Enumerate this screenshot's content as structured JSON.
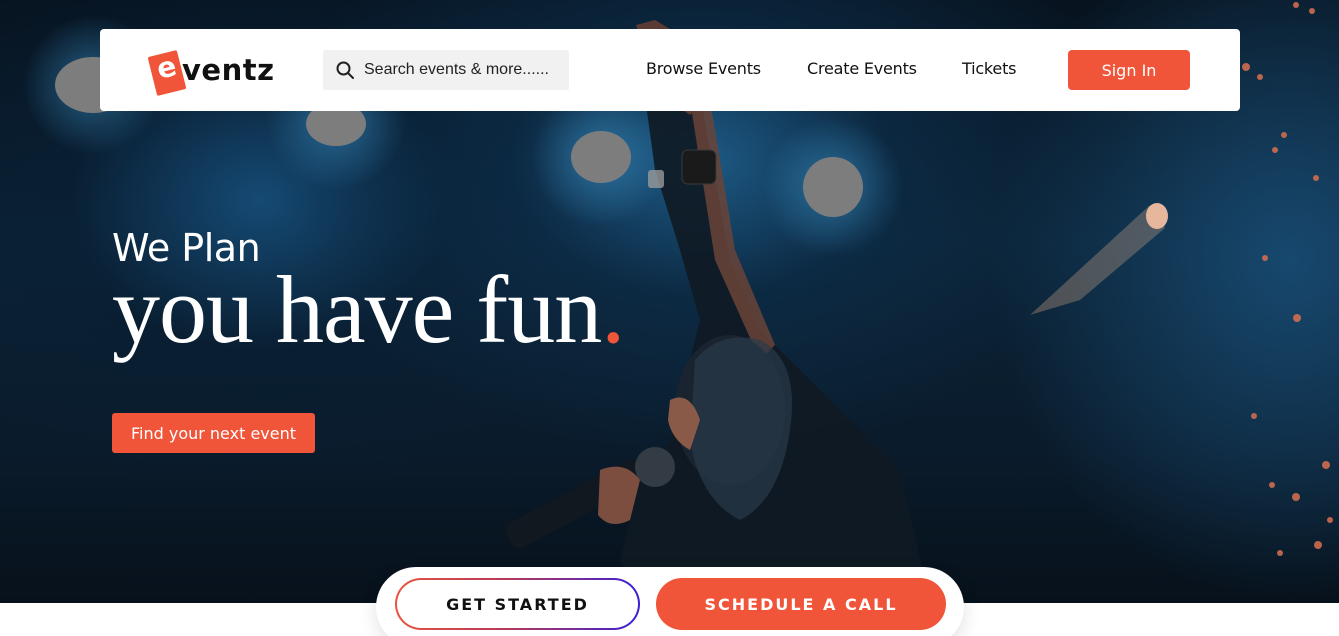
{
  "brand": {
    "logo_letter": "e",
    "logo_text": "ventz",
    "accent_color": "#f0553a"
  },
  "search": {
    "placeholder": "Search events & more......",
    "icon": "search-icon"
  },
  "nav": {
    "links": [
      "Browse Events",
      "Create Events",
      "Tickets"
    ],
    "sign_in": "Sign In"
  },
  "hero": {
    "headline_small": "We Plan",
    "headline_big": "you have fun",
    "headline_dot": ".",
    "cta": "Find your next event"
  },
  "actions": {
    "get_started": "GET STARTED",
    "schedule_call": "SCHEDULE A CALL"
  }
}
